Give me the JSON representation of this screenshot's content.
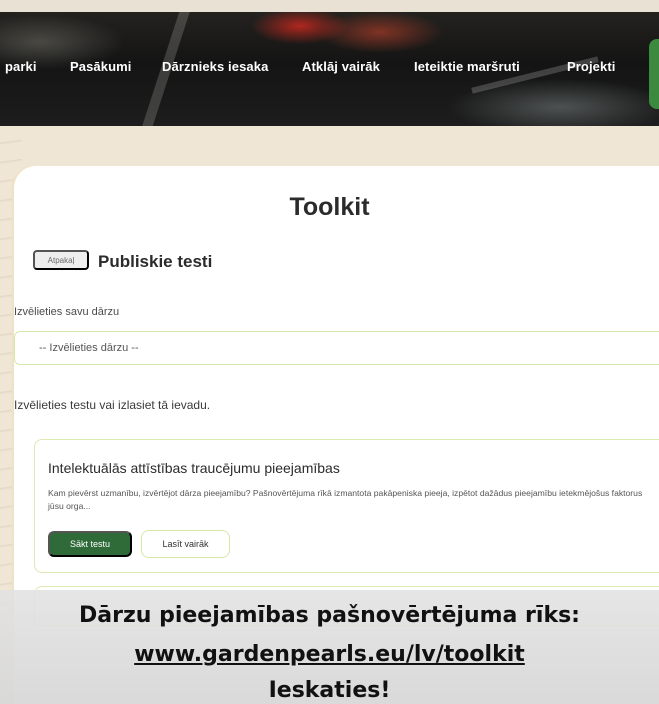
{
  "nav": {
    "items": [
      {
        "label": "parki"
      },
      {
        "label": "Pasākumi"
      },
      {
        "label": "Dārznieks iesaka"
      },
      {
        "label": "Atklāj vairāk"
      },
      {
        "label": "Ieteiktie maršruti"
      },
      {
        "label": "Projekti"
      }
    ]
  },
  "page": {
    "title": "Toolkit",
    "back_label": "Atpakaļ",
    "section_title": "Publiskie testi"
  },
  "garden_select": {
    "label": "Izvēlieties savu dārzu",
    "selected": "-- Izvēlieties dārzu --"
  },
  "intro_text": "Izvēlieties testu vai izlasiet tā ievadu.",
  "tests": [
    {
      "title": "Intelektuālās attīstības traucējumu pieejamības",
      "description": "Kam pievērst uzmanību, izvērtējot dārza pieejamību? Pašnovērtējuma rīkā izmantota pakāpeniska pieeja, izpētot dažādus pieejamību ietekmējošus faktorus jūsu orga...",
      "start_label": "Sākt testu",
      "read_more_label": "Lasīt vairāk"
    }
  ],
  "banner": {
    "line1": "Dārzu pieejamības pašnovērtējuma rīks:",
    "link": "www.gardenpearls.eu/lv/toolkit ",
    "line3": "Ieskaties!"
  },
  "colors": {
    "primary_green": "#2f6b39",
    "accent_border": "#d7e8a6",
    "nav_cta": "#3c8a3f"
  }
}
